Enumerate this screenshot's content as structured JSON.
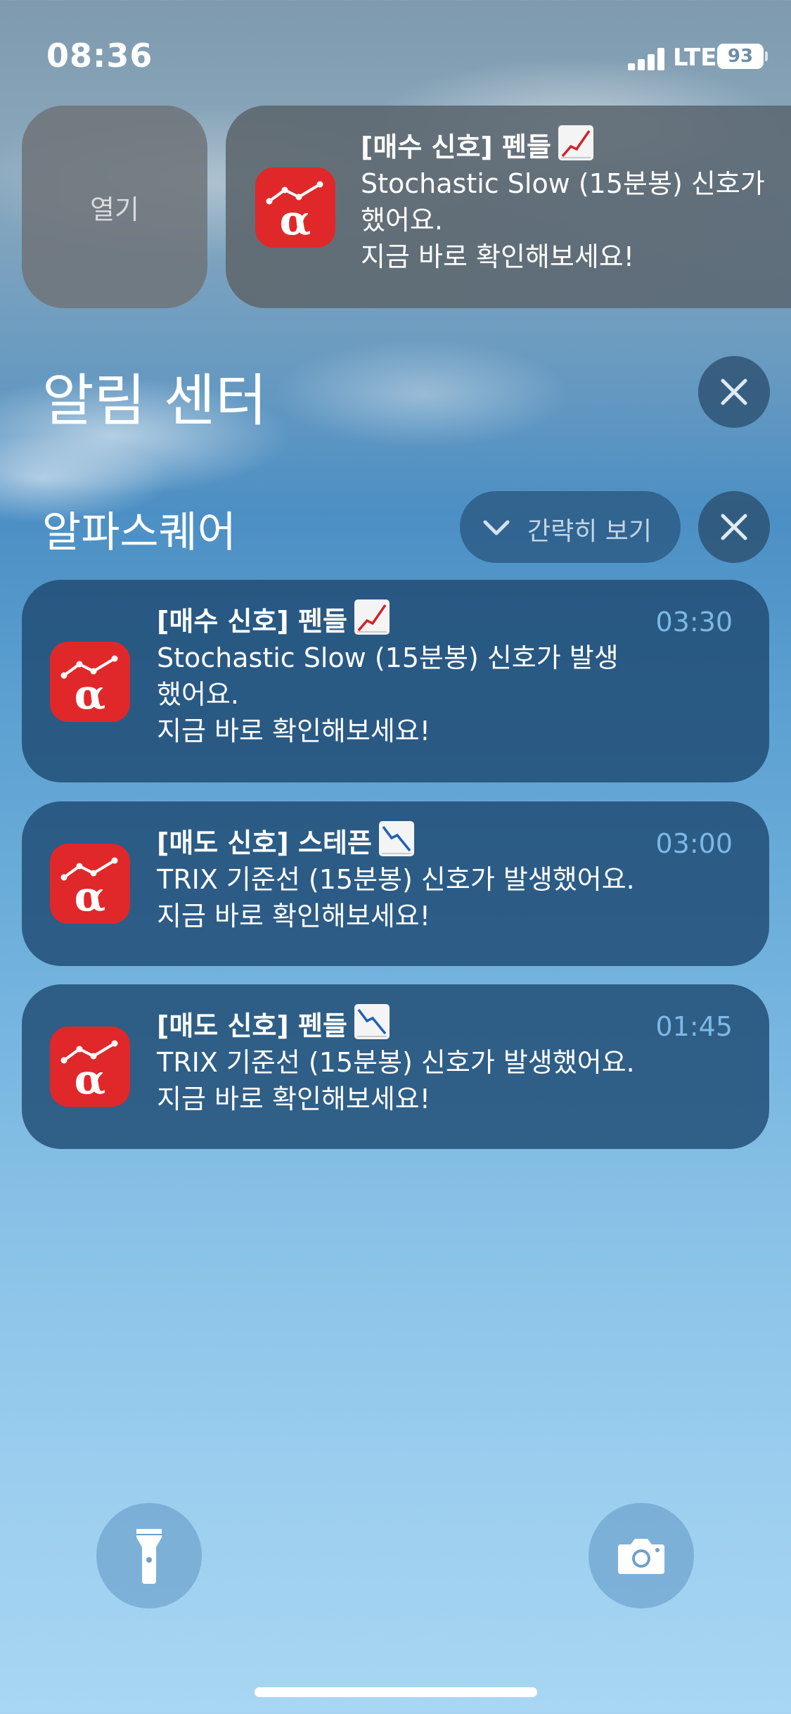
{
  "status_bar": {
    "time": "08:36",
    "network": "LTE",
    "battery": "93"
  },
  "banner": {
    "open_label": "열기",
    "title": "[매수 신호] 펜들",
    "title_emoji": "chart-increasing-icon",
    "line1": "Stochastic Slow (15분봉) 신호가",
    "line2": "했어요.",
    "line3": "지금 바로 확인해보세요!"
  },
  "notification_center": {
    "title": "알림 센터"
  },
  "group": {
    "app_name": "알파스퀘어",
    "collapse_label": "간략히 보기"
  },
  "notifications": [
    {
      "title": "[매수 신호] 펜들",
      "emoji": "chart-increasing-icon",
      "time": "03:30",
      "line1": "Stochastic Slow (15분봉) 신호가 발생",
      "line2": "했어요.",
      "line3": "지금 바로 확인해보세요!"
    },
    {
      "title": "[매도 신호] 스테픈",
      "emoji": "chart-decreasing-icon",
      "time": "03:00",
      "line1": "TRIX 기준선 (15분봉) 신호가 발생했어요.",
      "line2": "지금 바로 확인해보세요!"
    },
    {
      "title": "[매도 신호] 펜들",
      "emoji": "chart-decreasing-icon",
      "time": "01:45",
      "line1": "TRIX 기준선 (15분봉) 신호가 발생했어요.",
      "line2": "지금 바로 확인해보세요!"
    }
  ],
  "colors": {
    "app_icon": "#e0282a",
    "time_text": "#82beeb"
  }
}
